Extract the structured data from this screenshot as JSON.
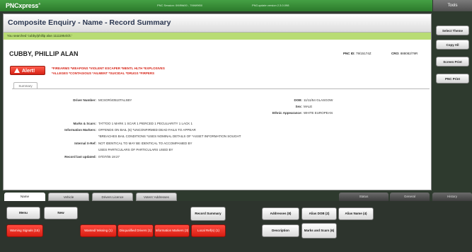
{
  "header": {
    "brand": "PNCxpress",
    "brand_mark": "®",
    "session": "PNC Session: 0f4f9fd00 - 7f4f4f9f00",
    "version": "PNCupdate version 2.3.0.098",
    "tools_label": "Tools"
  },
  "page": {
    "title": "Composite Enquiry - Name - Record Summary",
    "search_text": "You searched 'cubby/phillip alan 11111954/clt.'"
  },
  "subject": {
    "name": "CUBBY, PHILLIP ALAN",
    "pnc_id_label": "PNC ID:",
    "pnc_id": "79/15174Z",
    "cro_label": "CRO:",
    "cro": "888082/79R"
  },
  "alert": {
    "label": "Alert!",
    "line1": "*FIREARMS *WEAPONS *VIOLENT ESCAPER *MENTL HLTH *EXPLOSIVES",
    "line2": "*ALLEGES *CONTAGIOUS *AILMENT *SUICIDAL *DRUGS *FIRPERS"
  },
  "summary": {
    "tab_label": "Summary",
    "fields": {
      "driver_number": {
        "label": "Driver Number:",
        "value": "MCSOR/40510TALSBY"
      },
      "dob": {
        "label": "DOB:",
        "value": "11/11/54 GLASGOW"
      },
      "sex": {
        "label": "Sex:",
        "value": "MALE"
      },
      "ethnic": {
        "label": "Ethnic Appearance:",
        "value": "WHITE EUROPEAN"
      },
      "marks": {
        "label": "Marks & Scars:",
        "value": "TATTOO 1 MARK 1 SCAR 1 PIERCED 1 PECULIARITY 1 LACK 1"
      },
      "info_markers": {
        "label": "Information Markers:",
        "value": "OFFENDS ON BAIL (6) *UNCONFIRMED DEAD FAILS TO APPEAR"
      },
      "info_markers_2": {
        "value": "*BREACHES BAIL CONDITIONS *USES NOMINAL DETAILS OF *ASSET INFORMATION SOUGHT"
      },
      "internal_x_ref": {
        "label": "Internal X-Ref:",
        "value": "NOT IDENTICAL TO MAY BE IDENTICAL TO ACCOMPANIED BY"
      },
      "internal_x_ref_2": {
        "value": "USES PARTICULARS OF PARTICULARS USED BY"
      },
      "last_updated": {
        "label": "Record last updated:",
        "value": "07/07/05 19:27"
      }
    }
  },
  "side_buttons": [
    "Select Theme",
    "Copy All",
    "Screen Print",
    "PNC Print"
  ],
  "bottom_tabs": {
    "left": [
      "Name",
      "Vehicle",
      "Drivers Licence",
      "Voters' Addresses"
    ],
    "right": [
      "Status",
      "General",
      "History"
    ]
  },
  "bottom_buttons": {
    "menu": "Menu",
    "new": "New",
    "record_summary": "Record Summary",
    "addresses": "Addresses (8)",
    "alias_dob": "Alias DOB (2)",
    "alias_name": "Alias Name (4)",
    "warning_signals": "Warning Signals (15)",
    "wanted_missing": "Wanted/ Missing (1)",
    "disqualified_drivers": "Disqualified Drivers (1)",
    "information_markers": "Information Markers (3)",
    "local_refs": "Local Ref(s) (1)",
    "description": "Description",
    "marks_and_scars": "Marks and Scars (6)"
  }
}
